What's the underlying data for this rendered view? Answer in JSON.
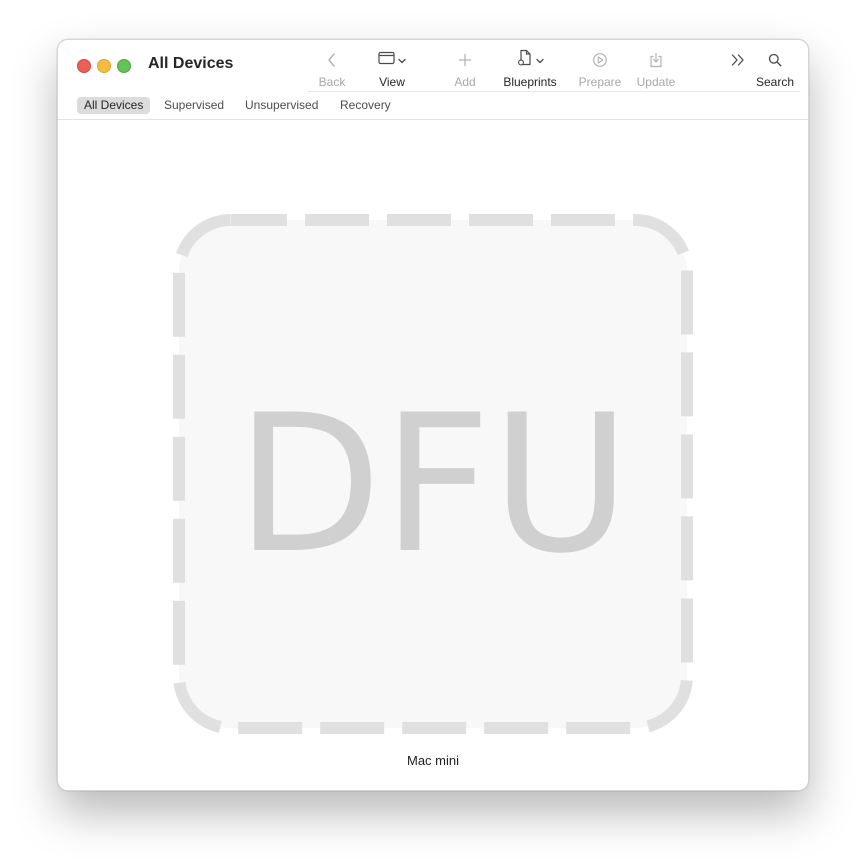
{
  "window": {
    "title": "All Devices"
  },
  "toolbar": {
    "back_label": "Back",
    "view_label": "View",
    "add_label": "Add",
    "blueprints_label": "Blueprints",
    "prepare_label": "Prepare",
    "update_label": "Update",
    "search_label": "Search"
  },
  "scope": {
    "items": [
      "All Devices",
      "Supervised",
      "Unsupervised",
      "Recovery"
    ],
    "selected": "All Devices"
  },
  "device": {
    "state_text": "DFU",
    "name": "Mac mini"
  },
  "colors": {
    "close": "#ec5f57",
    "minimize": "#f4bd3f",
    "maximize": "#61c454",
    "tile_fill": "#f8f8f8",
    "tile_dash": "#e0e0e0",
    "dfu_text": "#d0d0d0"
  },
  "icons": {
    "back": "chevron-left-icon",
    "view": "window-icon",
    "add": "plus-icon",
    "blueprints": "document-icon",
    "prepare": "prepare-icon",
    "update": "update-icon",
    "overflow": "double-chevron-right-icon",
    "search": "magnifier-icon"
  }
}
